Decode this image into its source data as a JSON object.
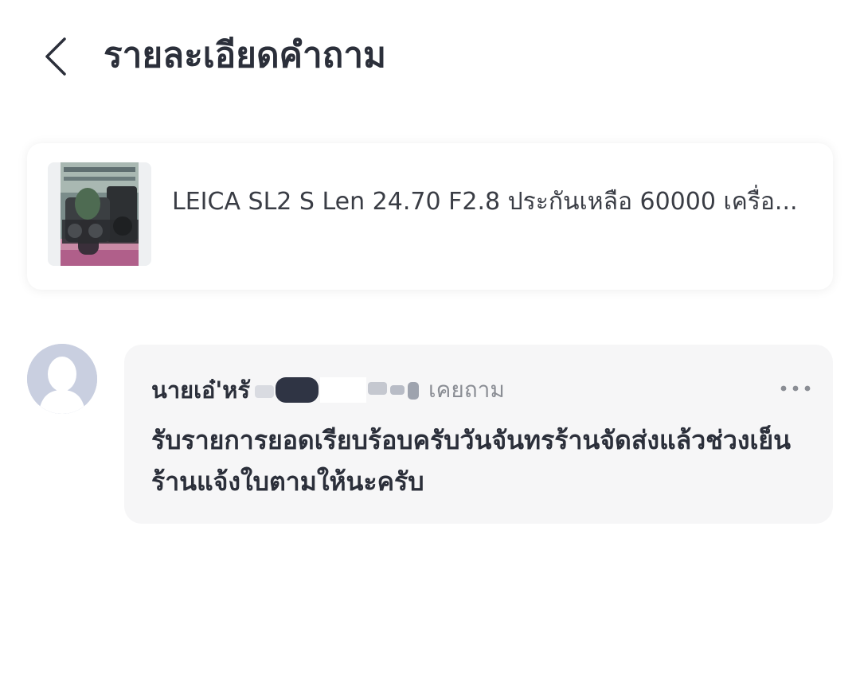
{
  "header": {
    "title": "รายละเอียดคำถาม",
    "back_icon": "chevron-left-icon"
  },
  "product": {
    "title": "LEICA SL2 S Len 24.70 F2.8 ประกันเหลือ 60000 เครื่อ..."
  },
  "answer": {
    "author_name": "นายเอ๋'หรั",
    "asked_label": "เคยถาม",
    "more_icon": "more-horizontal-icon",
    "text": "รับรายการยอดเรียบร้อบครับวันจันทรร้านจัดส่งแล้วช่วงเย็นร้านแจ้งใบตามให้นะครับ"
  },
  "colors": {
    "title_text": "#2b2f3a",
    "muted_text": "#8a8d94",
    "bubble_bg": "#f6f6f7",
    "avatar_bg": "#c9cfe0",
    "redaction": "#2f3444"
  }
}
